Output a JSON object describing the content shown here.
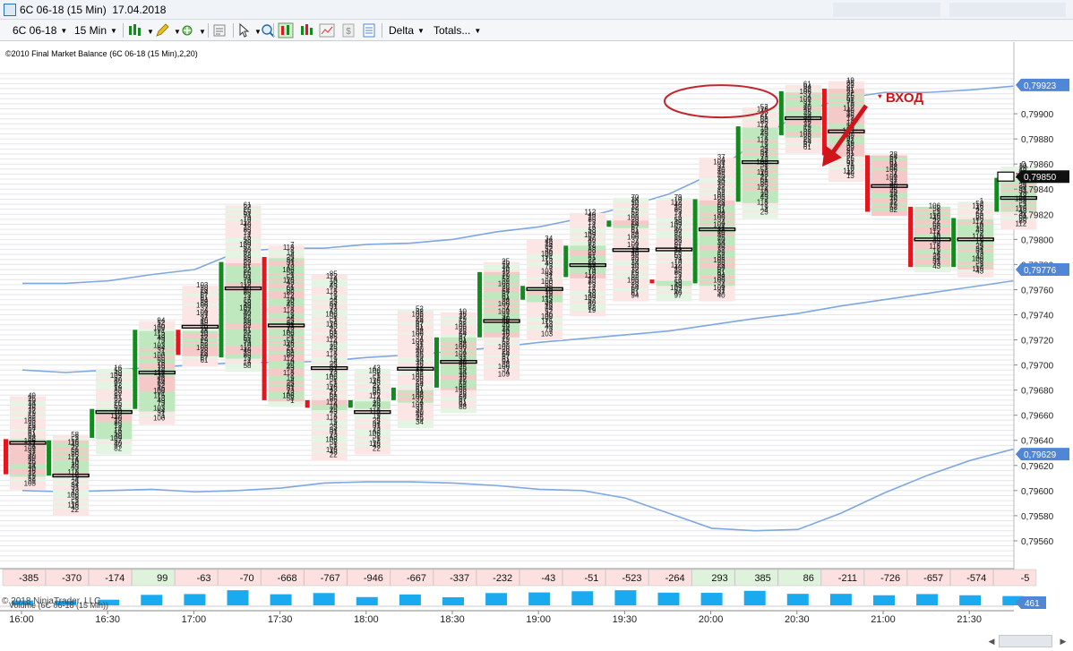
{
  "window": {
    "title": "6C 06-18 (15 Min)  17.04.2018"
  },
  "toolbar": {
    "instrument": "6C 06-18",
    "interval": "15 Min",
    "delta": "Delta",
    "totals": "Totals..."
  },
  "indicator_label": "©2010 Final Market Balance  (6C 06-18 (15 Min),2,20)",
  "copyright": "© 2018 NinjaTrader, LLC",
  "volume_label": "Volume (6C 06-18 (15 Min))",
  "volume_value": "461",
  "annotation": {
    "entry_label": "ВХОД",
    "colors": {
      "arrow": "#d0151a",
      "ellipse": "#c0262c"
    }
  },
  "price_axis": {
    "labels": [
      "0,79560",
      "0,79580",
      "0,79600",
      "0,79620",
      "0,79640",
      "0,79660",
      "0,79680",
      "0,79700",
      "0,79720",
      "0,79740",
      "0,79760",
      "0,79780",
      "0,79800",
      "0,79820",
      "0,79840",
      "0,79860",
      "0,79880",
      "0,79900"
    ],
    "markers": [
      {
        "value": "0,79923",
        "kind": "upper"
      },
      {
        "value": "0,79850",
        "kind": "last"
      },
      {
        "value": "0,79776",
        "kind": "upper"
      },
      {
        "value": "0,79629",
        "kind": "upper"
      }
    ]
  },
  "time_axis": {
    "labels": [
      "16:00",
      "16:30",
      "17:00",
      "17:30",
      "18:00",
      "18:30",
      "19:00",
      "19:30",
      "20:00",
      "20:30",
      "21:00",
      "21:30"
    ]
  },
  "colors": {
    "bull": "#138a1e",
    "bear": "#e2161c",
    "band": "#7fa7e0",
    "volume": "#1aaaf0",
    "grid": "#e4e6ea",
    "marker_fill": "#4f86d6",
    "last_fill": "#101010"
  },
  "chart_data": {
    "type": "candlestick-footprint",
    "timeframe": "15 Min",
    "candles": [
      {
        "open": 0.79641,
        "high": 0.79675,
        "low": 0.79603,
        "close": 0.79613,
        "delta": "-385"
      },
      {
        "open": 0.79612,
        "high": 0.79644,
        "low": 0.79582,
        "close": 0.7964,
        "delta": "-370"
      },
      {
        "open": 0.79642,
        "high": 0.79697,
        "low": 0.7963,
        "close": 0.79665,
        "delta": "-174"
      },
      {
        "open": 0.79665,
        "high": 0.79735,
        "low": 0.79655,
        "close": 0.79728,
        "delta": "99"
      },
      {
        "open": 0.79728,
        "high": 0.79763,
        "low": 0.797,
        "close": 0.79708,
        "delta": "-63"
      },
      {
        "open": 0.79706,
        "high": 0.79827,
        "low": 0.79697,
        "close": 0.79782,
        "delta": "-70"
      },
      {
        "open": 0.79786,
        "high": 0.79795,
        "low": 0.7967,
        "close": 0.79672,
        "delta": "-668"
      },
      {
        "open": 0.79672,
        "high": 0.79772,
        "low": 0.79625,
        "close": 0.79666,
        "delta": "-767"
      },
      {
        "open": 0.79666,
        "high": 0.79697,
        "low": 0.7963,
        "close": 0.79672,
        "delta": "-946"
      },
      {
        "open": 0.79672,
        "high": 0.79744,
        "low": 0.79652,
        "close": 0.79682,
        "delta": "-667"
      },
      {
        "open": 0.79682,
        "high": 0.79742,
        "low": 0.79665,
        "close": 0.79722,
        "delta": "-337"
      },
      {
        "open": 0.79722,
        "high": 0.79782,
        "low": 0.7969,
        "close": 0.79774,
        "delta": "-232"
      },
      {
        "open": 0.79752,
        "high": 0.798,
        "low": 0.79723,
        "close": 0.79763,
        "delta": "-43"
      },
      {
        "open": 0.7977,
        "high": 0.79821,
        "low": 0.7974,
        "close": 0.79795,
        "delta": "-51"
      },
      {
        "open": 0.7981,
        "high": 0.79833,
        "low": 0.79752,
        "close": 0.79815,
        "delta": "-523"
      },
      {
        "open": 0.79768,
        "high": 0.79833,
        "low": 0.79753,
        "close": 0.79765,
        "delta": "-264"
      },
      {
        "open": 0.79765,
        "high": 0.79865,
        "low": 0.79753,
        "close": 0.79832,
        "delta": "293"
      },
      {
        "open": 0.7983,
        "high": 0.79905,
        "low": 0.7982,
        "close": 0.7989,
        "delta": "385"
      },
      {
        "open": 0.79883,
        "high": 0.79923,
        "low": 0.79872,
        "close": 0.79918,
        "delta": "86"
      },
      {
        "open": 0.7992,
        "high": 0.79926,
        "low": 0.79848,
        "close": 0.79867,
        "delta": "-211"
      },
      {
        "open": 0.79867,
        "high": 0.79867,
        "low": 0.7982,
        "close": 0.79822,
        "delta": "-726"
      },
      {
        "open": 0.79826,
        "high": 0.79826,
        "low": 0.79776,
        "close": 0.79778,
        "delta": "-657"
      },
      {
        "open": 0.79778,
        "high": 0.7983,
        "low": 0.79772,
        "close": 0.79817,
        "delta": "-574"
      },
      {
        "open": 0.79822,
        "high": 0.79858,
        "low": 0.7981,
        "close": 0.79849,
        "delta": "-5"
      }
    ],
    "bands": {
      "upper": [
        0.79765,
        0.79765,
        0.79767,
        0.79772,
        0.79776,
        0.7979,
        0.79793,
        0.79793,
        0.79796,
        0.79797,
        0.798,
        0.79806,
        0.7981,
        0.79817,
        0.79826,
        0.79836,
        0.79852,
        0.79877,
        0.799,
        0.79912,
        0.79917,
        0.79917,
        0.79919,
        0.79922
      ],
      "middle": [
        0.79696,
        0.79694,
        0.79696,
        0.79698,
        0.797,
        0.79702,
        0.79702,
        0.79703,
        0.79706,
        0.79708,
        0.79711,
        0.79714,
        0.79718,
        0.79721,
        0.79724,
        0.79727,
        0.79732,
        0.79737,
        0.79741,
        0.79747,
        0.79752,
        0.79757,
        0.79762,
        0.79767
      ],
      "lower": [
        0.796,
        0.79599,
        0.796,
        0.79601,
        0.79599,
        0.796,
        0.79602,
        0.79606,
        0.79607,
        0.79607,
        0.79606,
        0.79604,
        0.79601,
        0.796,
        0.79594,
        0.79582,
        0.7957,
        0.79568,
        0.79569,
        0.79582,
        0.79598,
        0.79612,
        0.79624,
        0.79633
      ]
    },
    "volume": [
      24,
      23,
      28,
      52,
      56,
      75,
      55,
      61,
      41,
      54,
      40,
      61,
      64,
      70,
      75,
      63,
      62,
      72,
      57,
      57,
      50,
      56,
      50,
      46
    ],
    "y_axis": {
      "min": 0.7954,
      "max": 0.79935,
      "tick_step": 0.0002
    },
    "x_axis": {
      "labels": [
        "16:00",
        "16:30",
        "17:00",
        "17:30",
        "18:00",
        "18:30",
        "19:00",
        "19:30",
        "20:00",
        "20:30",
        "21:00",
        "21:30"
      ]
    },
    "grid": true
  }
}
